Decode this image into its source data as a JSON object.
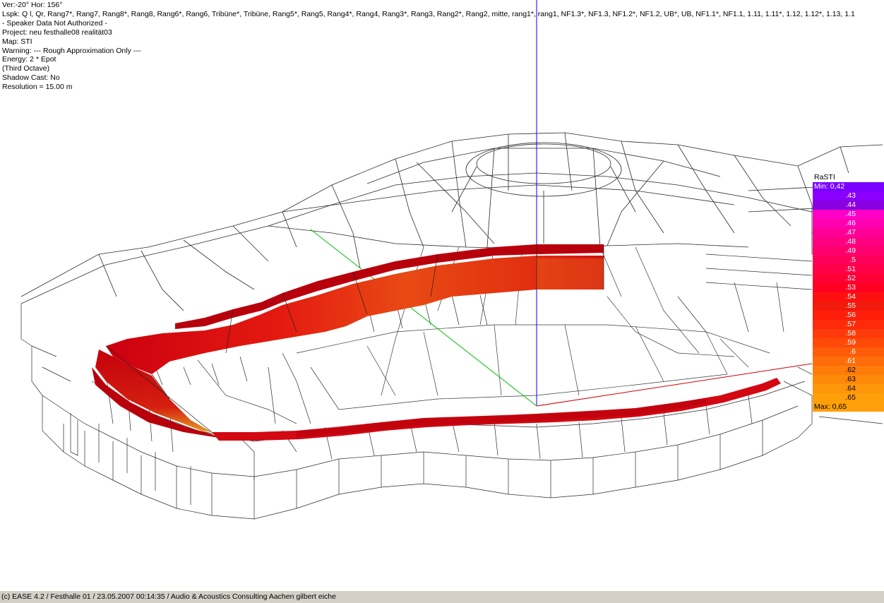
{
  "info": [
    "Ver:-20°   Hor: 156°",
    "Lspk: Q l, Qr, Rang7*, Rang7, Rang8*, Rang8, Rang6*, Rang6, Tribüne*, Tribüne, Rang5*, Rang5, Rang4*, Rang4, Rang3*, Rang3, Rang2*, Rang2, mitte, rang1*, rang1, NF1.3*, NF1.3, NF1.2*, NF1.2, UB*, UB, NF1.1*, NF1.1, 1.11, 1.11*, 1.12, 1.12*, 1.13, 1.1",
    "- Speaker Data Not Authorized -",
    "Project: neu festhalle08 realität03",
    "Map: STI",
    "Warning:   ---  Rough Approximation Only  ---",
    "Energy: 2 * Epot",
    "(Third Octave)",
    "Shadow Cast: No",
    "Resolution =  15.00 m"
  ],
  "legend": {
    "title": "RaSTI",
    "min_label": "Min:",
    "min_value": "0,42",
    "max_label": "Max:",
    "max_value": "0,65",
    "steps": [
      {
        "label": ".43",
        "color": "#8a00ff"
      },
      {
        "label": ".44",
        "color": "#8800e0"
      },
      {
        "label": ".45",
        "color": "#ff00c8"
      },
      {
        "label": ".46",
        "color": "#ff00b0"
      },
      {
        "label": ".47",
        "color": "#ff0096"
      },
      {
        "label": ".48",
        "color": "#ff0080"
      },
      {
        "label": ".49",
        "color": "#ff006c"
      },
      {
        "label": ".5",
        "color": "#ff0058"
      },
      {
        "label": ".51",
        "color": "#ff0046"
      },
      {
        "label": ".52",
        "color": "#ff0034"
      },
      {
        "label": ".53",
        "color": "#ff0022"
      },
      {
        "label": ".54",
        "color": "#ff1010"
      },
      {
        "label": ".55",
        "color": "#f21a0a"
      },
      {
        "label": ".56",
        "color": "#ff1e0a"
      },
      {
        "label": ".57",
        "color": "#ff2a0a"
      },
      {
        "label": ".58",
        "color": "#ff3a0a"
      },
      {
        "label": ".59",
        "color": "#ff4a0a"
      },
      {
        "label": ".6",
        "color": "#ff5c0a"
      },
      {
        "label": ".61",
        "color": "#ff6c0a"
      },
      {
        "label": ".62",
        "color": "#ff7c0a"
      },
      {
        "label": ".63",
        "color": "#ff8a0a"
      },
      {
        "label": ".64",
        "color": "#ff960a"
      },
      {
        "label": ".65",
        "color": "#ffa00a"
      }
    ],
    "colors": {
      "min": "#7a00ff",
      "max": "#ffa00a"
    }
  },
  "status": "(c) EASE 4.2  / Festhalle 01 / 23.05.2007 00:14:35 / Audio & Acoustics Consulting Aachen gilbert eiche",
  "colors": {
    "wireframe": "#2a2a2a",
    "axis_vertical": "#0000ff",
    "axis_green": "#00c000",
    "axis_red": "#d00000",
    "band_dark": "#b8000c",
    "band_mid": "#e00808",
    "band_light": "#e84a10"
  }
}
